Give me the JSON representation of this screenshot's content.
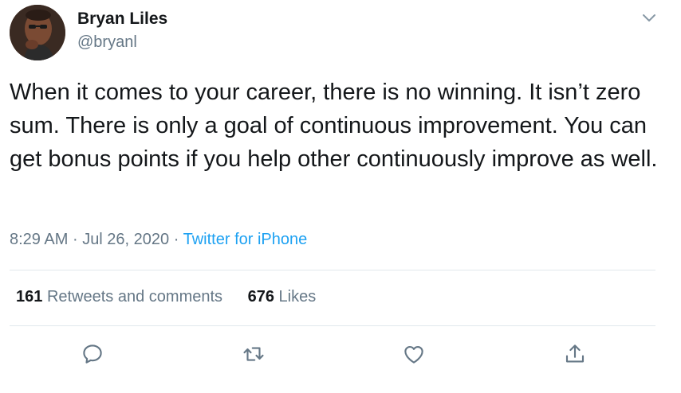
{
  "author": {
    "name": "Bryan Liles",
    "handle": "@bryanl"
  },
  "tweet": {
    "text": "When it comes to your career, there is no winning. It isn’t zero sum. There is only a goal of continuous improvement. You can get bonus points if you help other continuously improve as well."
  },
  "meta": {
    "time": "8:29 AM",
    "separator": "·",
    "date": "Jul 26, 2020",
    "source": "Twitter for iPhone"
  },
  "stats": {
    "retweets_count": "161",
    "retweets_label": "Retweets and comments",
    "likes_count": "676",
    "likes_label": "Likes"
  },
  "icons": {
    "caret": "chevron-down-icon",
    "reply": "reply-icon",
    "retweet": "retweet-icon",
    "like": "heart-icon",
    "share": "share-icon"
  },
  "colors": {
    "text": "#14171a",
    "secondary": "#657786",
    "link": "#1da1f2",
    "divider": "#e1e8ed"
  }
}
